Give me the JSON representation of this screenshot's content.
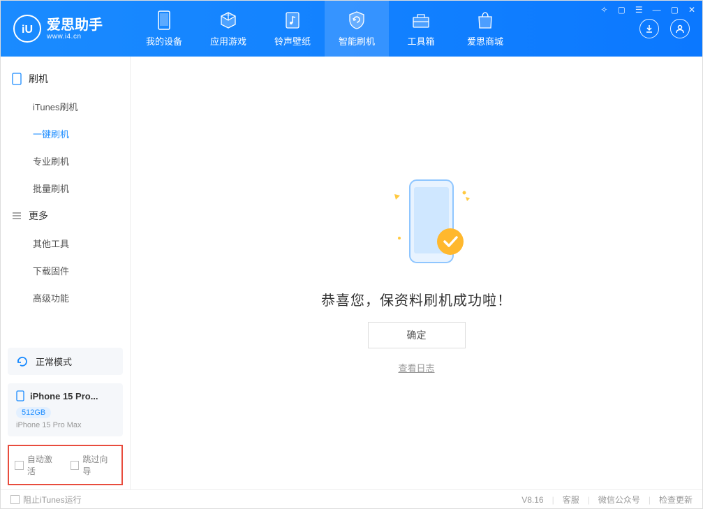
{
  "logo": {
    "name": "爱思助手",
    "url": "www.i4.cn"
  },
  "nav": {
    "device": "我的设备",
    "apps": "应用游戏",
    "ringtone": "铃声壁纸",
    "flash": "智能刷机",
    "toolbox": "工具箱",
    "store": "爱思商城"
  },
  "sidebar": {
    "group_flash": "刷机",
    "itunes_flash": "iTunes刷机",
    "one_click": "一键刷机",
    "pro_flash": "专业刷机",
    "batch_flash": "批量刷机",
    "group_more": "更多",
    "other_tools": "其他工具",
    "download_fw": "下载固件",
    "advanced": "高级功能"
  },
  "mode_label": "正常模式",
  "device_name": "iPhone 15 Pro...",
  "device_storage": "512GB",
  "device_full": "iPhone 15 Pro Max",
  "opt_auto_activate": "自动激活",
  "opt_skip_wizard": "跳过向导",
  "main": {
    "success_text": "恭喜您，保资料刷机成功啦！",
    "confirm_btn": "确定",
    "view_log": "查看日志"
  },
  "footer": {
    "block_itunes": "阻止iTunes运行",
    "version": "V8.16",
    "support": "客服",
    "wechat": "微信公众号",
    "check_update": "检查更新"
  }
}
